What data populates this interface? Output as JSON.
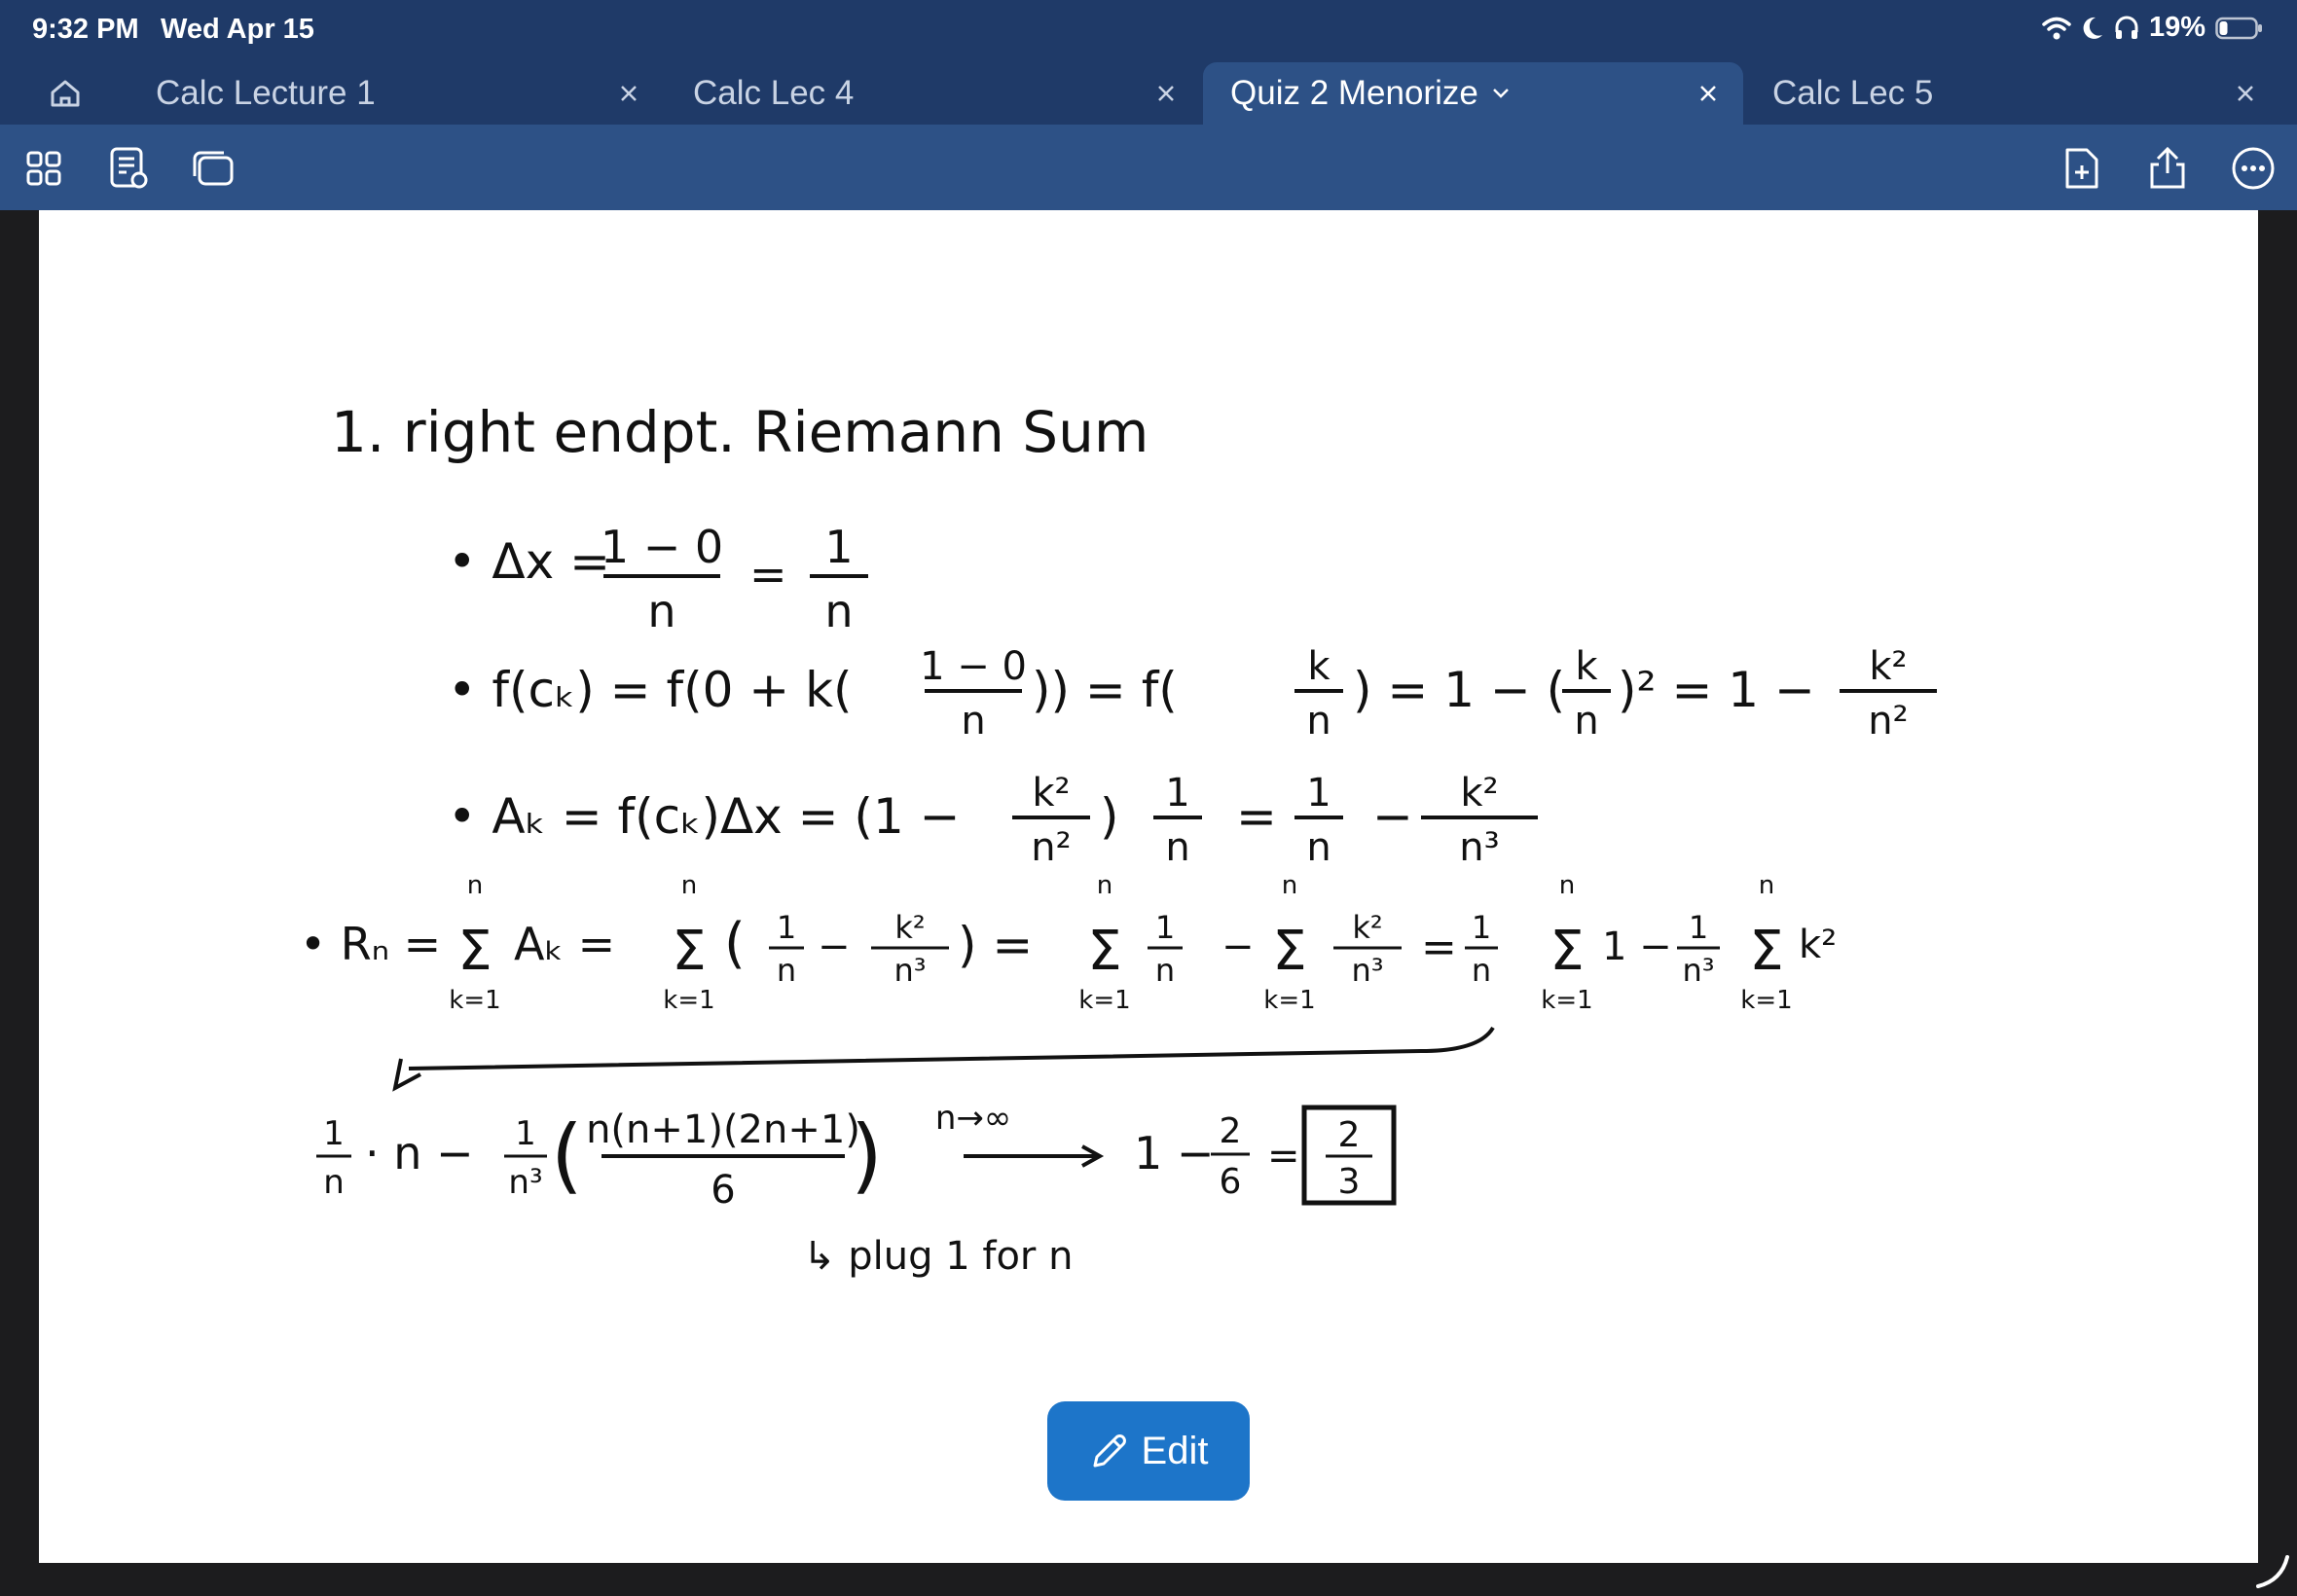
{
  "status_bar": {
    "time": "9:32 PM",
    "date": "Wed Apr 15",
    "battery": "19%",
    "icons": [
      "wifi-icon",
      "do-not-disturb-icon",
      "headphones-icon",
      "battery-icon"
    ]
  },
  "tabs": [
    {
      "label": "Calc Lecture 1",
      "active": false
    },
    {
      "label": "Calc Lec 4",
      "active": false
    },
    {
      "label": "Quiz 2 Menorize",
      "active": true
    },
    {
      "label": "Calc Lec 5",
      "active": false
    }
  ],
  "toolbar": {
    "left_icons": [
      "grid-icon",
      "notes-icon",
      "pages-icon"
    ],
    "right_icons": [
      "add-page-icon",
      "share-icon",
      "more-icon"
    ]
  },
  "notes": {
    "title": "1. right endpt. Riemann Sum",
    "line1": {
      "a": "• Δx =",
      "frac_num": "1 − 0",
      "frac_den": "n",
      "eq": "=",
      "frac2_num": "1",
      "frac2_den": "n"
    },
    "line2": {
      "a": "• f(cₖ) = f(0 + k(",
      "frac_num": "1 − 0",
      "frac_den": "n",
      "b": ")) = f(",
      "frac2_num": "k",
      "frac2_den": "n",
      "c": ") = 1 − (",
      "frac3_num": "k",
      "frac3_den": "n",
      "d": ")² = 1 −",
      "frac4_num": "k²",
      "frac4_den": "n²"
    },
    "line3": {
      "a": "• Aₖ = f(cₖ)Δx = (1 −",
      "frac_num": "k²",
      "frac_den": "n²",
      "b": ")",
      "frac2_num": "1",
      "frac2_den": "n",
      "c": "=",
      "frac3_num": "1",
      "frac3_den": "n",
      "d": "−",
      "frac4_num": "k²",
      "frac4_den": "n³"
    },
    "line4": {
      "a": "• Rₙ =",
      "sum1_top": "n",
      "sum1_bottom": "k=1",
      "b": "Aₖ =",
      "sum2_top": "n",
      "sum2_bottom": "k=1",
      "c": "(",
      "f1_num": "1",
      "f1_den": "n",
      "d": "−",
      "f2_num": "k²",
      "f2_den": "n³",
      "e": ") =",
      "sum3_top": "n",
      "sum3_bottom": "k=1",
      "f3_num": "1",
      "f3_den": "n",
      "g": "−",
      "sum4_top": "n",
      "sum4_bottom": "k=1",
      "f4_num": "k²",
      "f4_den": "n³",
      "h": "=",
      "f5_num": "1",
      "f5_den": "n",
      "sum5_top": "n",
      "sum5_bottom": "k=1",
      "i": "1 −",
      "f6_num": "1",
      "f6_den": "n³",
      "sum6_top": "n",
      "sum6_bottom": "k=1",
      "j": "k²"
    },
    "line5": {
      "f1_num": "1",
      "f1_den": "n",
      "a": "· n −",
      "f2_num": "1",
      "f2_den": "n³",
      "f3_num": "n(n+1)(2n+1)",
      "f3_den": "6",
      "arrow_label": "n→∞",
      "b": "1 −",
      "f4_num": "2",
      "f4_den": "6",
      "c": "=",
      "answer_num": "2",
      "answer_den": "3"
    },
    "footnote": "↳ plug 1 for n"
  },
  "edit_button": {
    "label": "Edit"
  }
}
